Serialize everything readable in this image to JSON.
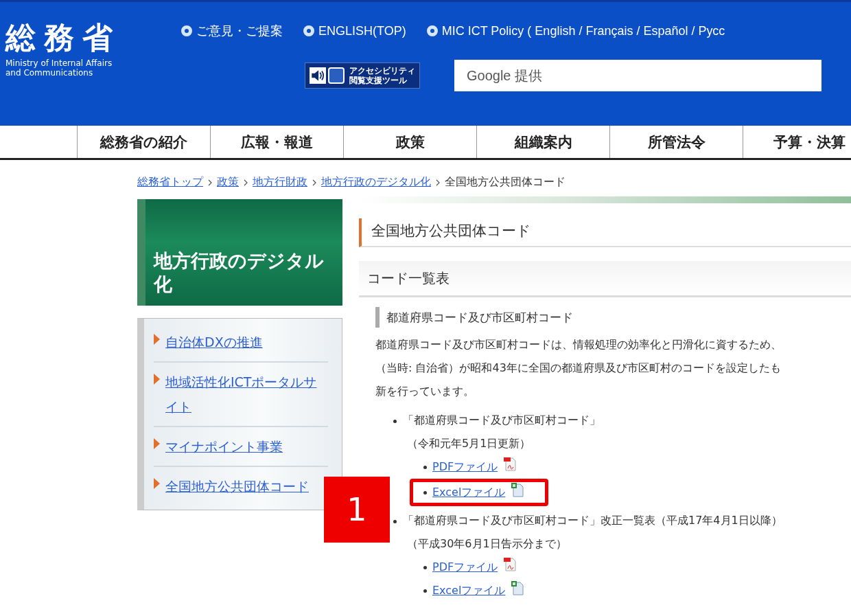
{
  "header": {
    "logo": {
      "title": "総務省",
      "subtitle": [
        "Ministry of Internal Affairs",
        "and Communications"
      ]
    },
    "links": [
      "ご意見・ご提案",
      "ENGLISH(TOP)",
      "MIC ICT Policy ( English / Français / Español / Русс"
    ],
    "accessibility_tool": {
      "lines": [
        "アクセシビリティ",
        "閲覧支援ツール"
      ]
    },
    "search": {
      "placeholder": "Google 提供"
    }
  },
  "nav": [
    "総務省の紹介",
    "広報・報道",
    "政策",
    "組織案内",
    "所管法令",
    "予算・決算"
  ],
  "breadcrumb": [
    {
      "label": "総務省トップ",
      "link": true
    },
    {
      "label": "政策",
      "link": true
    },
    {
      "label": "地方行財政",
      "link": true
    },
    {
      "label": "地方行政のデジタル化",
      "link": true
    },
    {
      "label": "全国地方公共団体コード",
      "link": false
    }
  ],
  "sidebar": {
    "title": "地方行政のデジタル化",
    "items": [
      "自治体DXの推進",
      "地域活性化ICTポータルサイト",
      "マイナポイント事業",
      "全国地方公共団体コード"
    ]
  },
  "main": {
    "page_title": "全国地方公共団体コード",
    "section_title": "コード一覧表",
    "subsection_title": "都道府県コード及び市区町村コード",
    "paragraph": [
      "都道府県コード及び市区町村コードは、情報処理の効率化と円滑化に資するため、",
      "（当時: 自治省）が昭和43年に全国の都道府県及び市区町村のコードを設定したも",
      "新を行っています。"
    ],
    "list": [
      {
        "text": "「都道府県コード及び市区町村コード」",
        "note": "（令和元年5月1日更新）",
        "files": [
          {
            "label": "PDFファイル",
            "kind": "pdf",
            "highlighted": false
          },
          {
            "label": "Excelファイル",
            "kind": "excel",
            "highlighted": true
          }
        ]
      },
      {
        "text": "「都道府県コード及び市区町村コード」改正一覧表（平成17年4月1日以降）",
        "note": "（平成30年6月1日告示分まで）",
        "files": [
          {
            "label": "PDFファイル",
            "kind": "pdf",
            "highlighted": false
          },
          {
            "label": "Excelファイル",
            "kind": "excel",
            "highlighted": false
          }
        ]
      }
    ]
  },
  "annotation": {
    "label": "1"
  }
}
